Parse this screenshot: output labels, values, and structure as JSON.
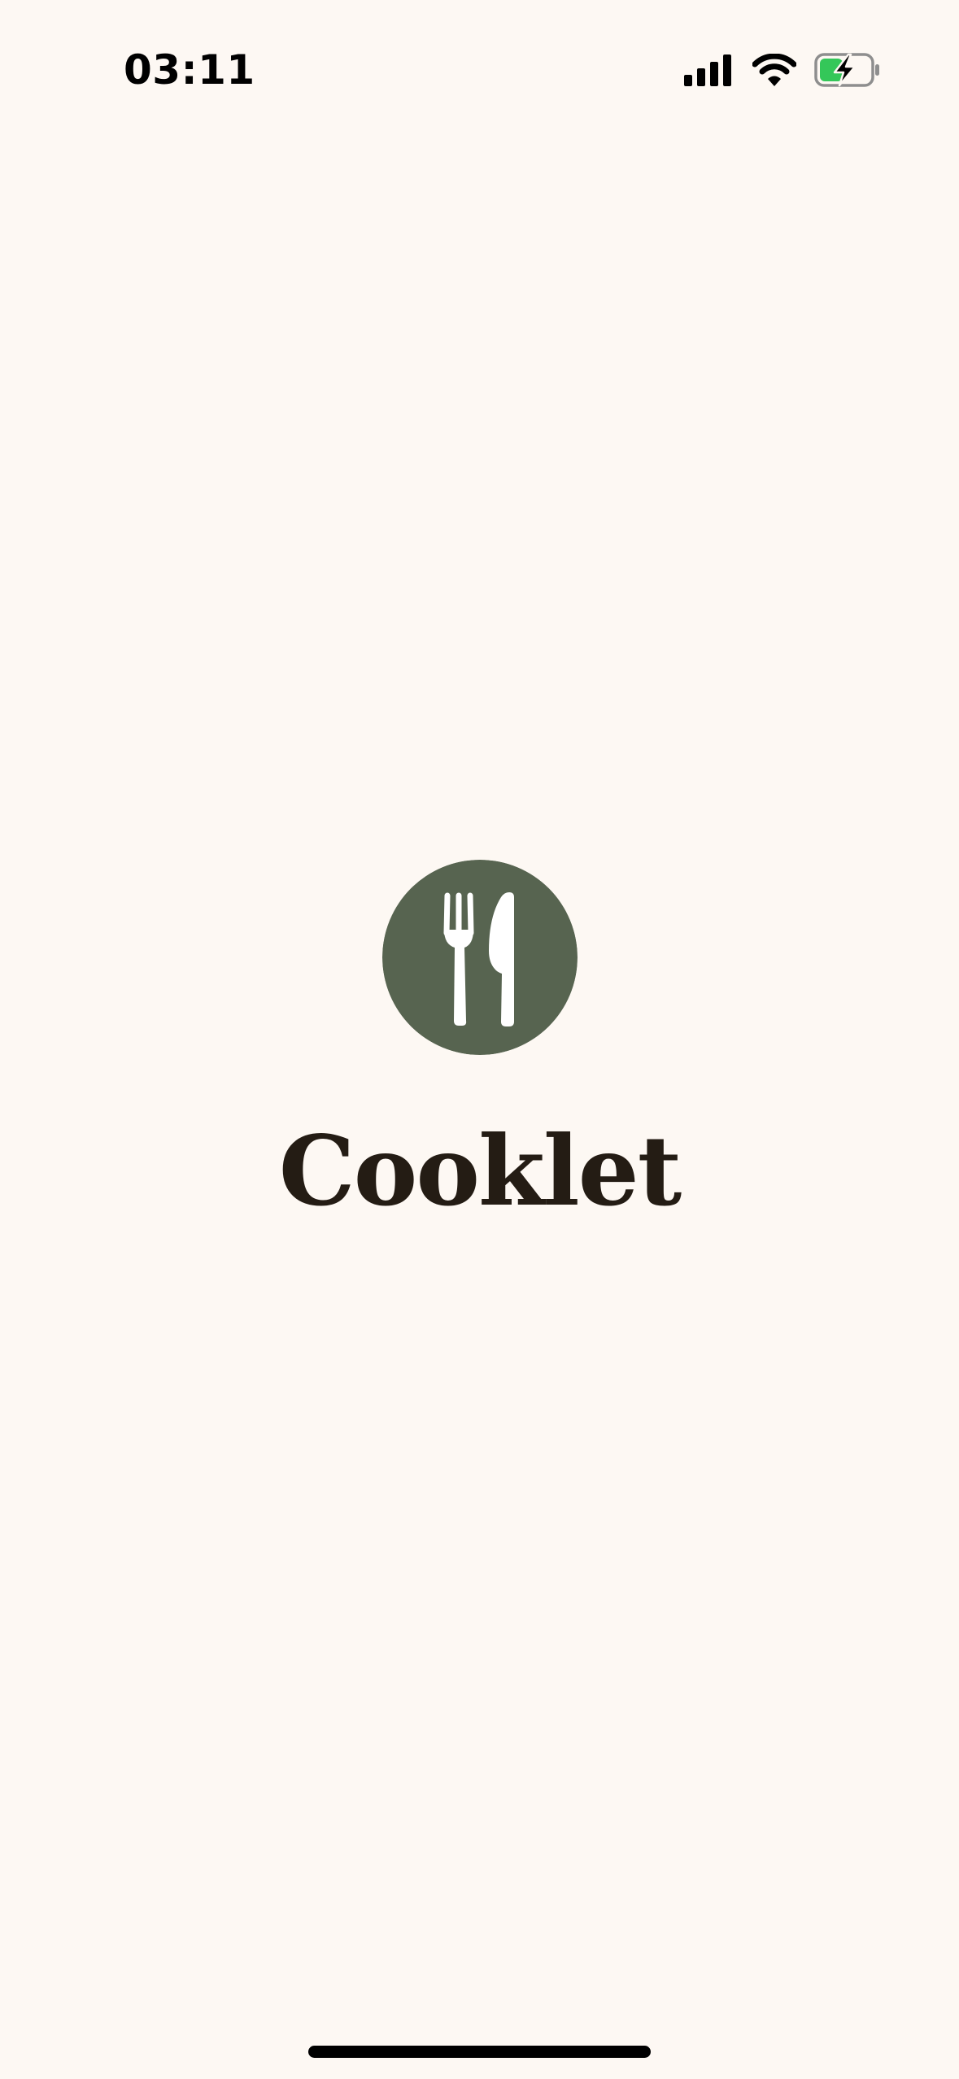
{
  "status_bar": {
    "time": "03:11",
    "icons": [
      "signal-bars-icon",
      "wifi-icon",
      "battery-charging-icon"
    ],
    "battery_accent": "#34c759"
  },
  "splash": {
    "logo_icon": "fork-knife-icon",
    "logo_color": "#576450",
    "app_name": "Cooklet"
  },
  "colors": {
    "background": "#fdf8f3",
    "title": "#241c14"
  }
}
